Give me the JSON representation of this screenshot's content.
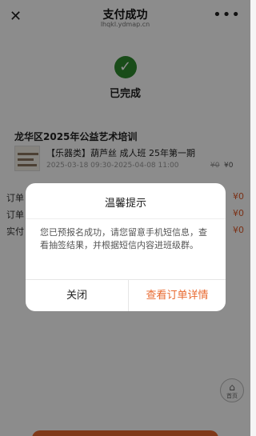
{
  "navbar": {
    "close_icon": "close-icon",
    "title": "支付成功",
    "url": "lhqkl.ydmap.cn",
    "more_icon": "more-icon"
  },
  "status": {
    "icon": "check-icon",
    "text": "已完成",
    "color": "#2f8a2f"
  },
  "order": {
    "title": "龙华区2025年公益艺术培训",
    "item_name": "【乐器类】葫芦丝 成人班 25年第一期",
    "item_date": "2025-03-18 09:30-2025-04-08 11:00",
    "price_old": "¥0",
    "price_new": "¥0"
  },
  "summary_rows": [
    {
      "label": "订单",
      "value": "¥0"
    },
    {
      "label": "订单",
      "value": "¥0"
    },
    {
      "label": "实付",
      "value": "¥0"
    }
  ],
  "home_button": {
    "icon": "home-icon",
    "label": "首页"
  },
  "dialog": {
    "title": "温馨提示",
    "body": "您已预报名成功，请您留意手机短信息，查看抽签结果，并根据短信内容进班级群。",
    "close_label": "关闭",
    "view_label": "查看订单详情",
    "accent": "#e8692f"
  }
}
